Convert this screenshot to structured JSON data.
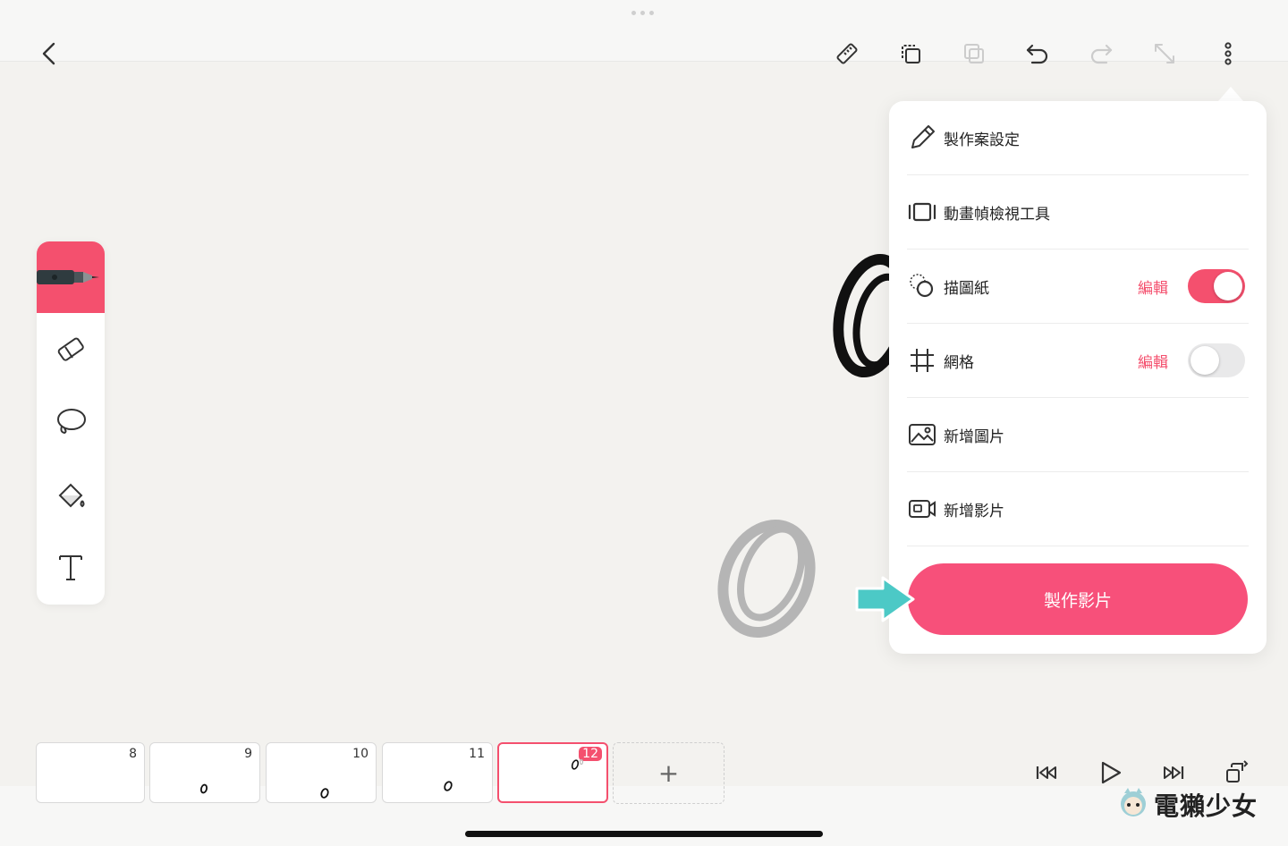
{
  "toolbar": {
    "icons": [
      "back-chevron-icon",
      "ruler-icon",
      "duplicate-layer-icon",
      "copy-disabled-icon",
      "undo-icon",
      "redo-disabled-icon",
      "expand-disabled-icon",
      "more-vertical-icon"
    ]
  },
  "tools": [
    {
      "name": "pen",
      "active": true
    },
    {
      "name": "eraser",
      "active": false
    },
    {
      "name": "lasso",
      "active": false
    },
    {
      "name": "fill-bucket",
      "active": false
    },
    {
      "name": "text",
      "active": false
    }
  ],
  "menu": {
    "items": [
      {
        "label": "製作案設定",
        "icon": "pencil-icon"
      },
      {
        "label": "動畫幀檢視工具",
        "icon": "frame-viewer-icon"
      },
      {
        "label": "描圖紙",
        "icon": "onion-skin-icon",
        "edit": "編輯",
        "toggle": true
      },
      {
        "label": "網格",
        "icon": "grid-icon",
        "edit": "編輯",
        "toggle": false
      },
      {
        "label": "新增圖片",
        "icon": "add-image-icon"
      },
      {
        "label": "新增影片",
        "icon": "add-video-icon"
      }
    ],
    "make_video_label": "製作影片"
  },
  "timeline": {
    "frames": [
      "8",
      "9",
      "10",
      "11",
      "12"
    ],
    "active_frame": "12",
    "add_label": "+"
  },
  "colors": {
    "accent": "#f4506e",
    "arrow": "#4cc9c6"
  },
  "watermark": "電獺少女"
}
